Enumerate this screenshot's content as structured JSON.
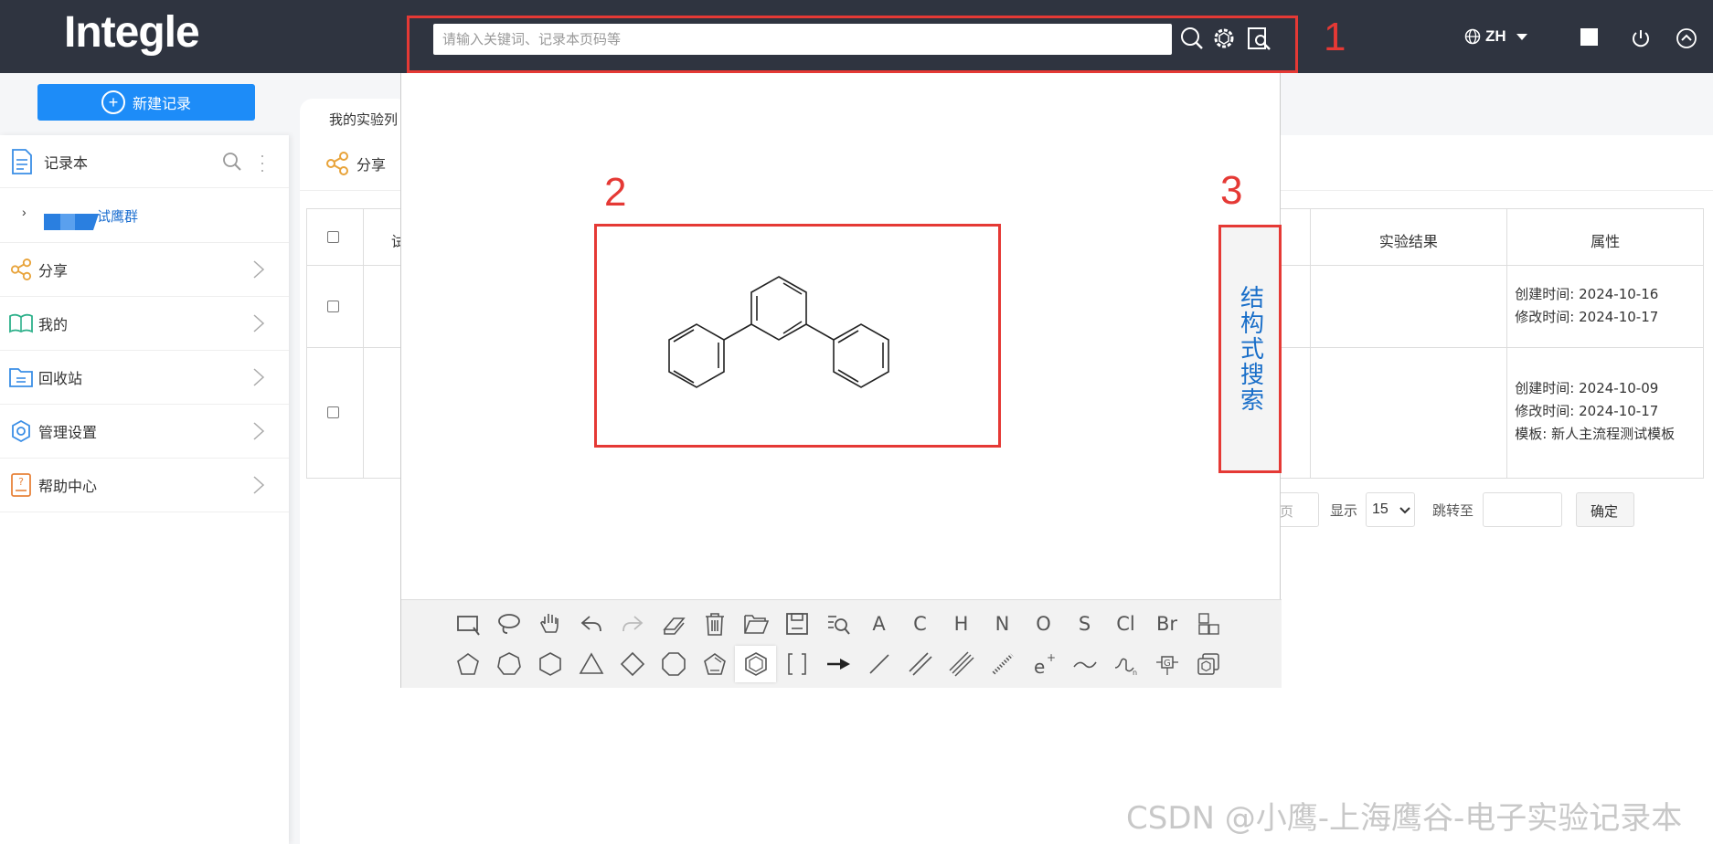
{
  "app": {
    "logo": "Integle"
  },
  "topbar": {
    "search_placeholder": "请输入关键词、记录本页码等",
    "lang": "ZH"
  },
  "annotations": {
    "n1": "1",
    "n2": "2",
    "n3": "3"
  },
  "sidebar": {
    "new_record": "新建记录",
    "notebook_title": "记录本",
    "group_label": "试鹰群",
    "items": [
      {
        "label": "分享",
        "icon": "share-icon"
      },
      {
        "label": "我的",
        "icon": "book-icon"
      },
      {
        "label": "回收站",
        "icon": "folder-icon"
      },
      {
        "label": "管理设置",
        "icon": "gear-icon"
      },
      {
        "label": "帮助中心",
        "icon": "help-icon"
      }
    ]
  },
  "main": {
    "tab": "我的实验列",
    "share": "分享",
    "table": {
      "headers": [
        "试",
        "实验结果",
        "属性"
      ],
      "rows": [
        {
          "prop1": "创建时间: 2024-10-16",
          "prop2": "修改时间: 2024-10-17",
          "prop3": ""
        },
        {
          "prop1": "创建时间: 2024-10-09",
          "prop2": "修改时间: 2024-10-17",
          "prop3": "模板: 新人主流程测试模板"
        }
      ]
    },
    "pagination": {
      "page_suffix": "页",
      "show_label": "显示",
      "page_size": "15",
      "jump_label": "跳转至",
      "confirm": "确定"
    }
  },
  "structure_search": {
    "side_label": "结构式搜索",
    "toolbar_atoms": [
      "A",
      "C",
      "H",
      "N",
      "O",
      "S",
      "Cl",
      "Br"
    ]
  },
  "watermark": "CSDN @小鹰-上海鹰谷-电子实验记录本"
}
